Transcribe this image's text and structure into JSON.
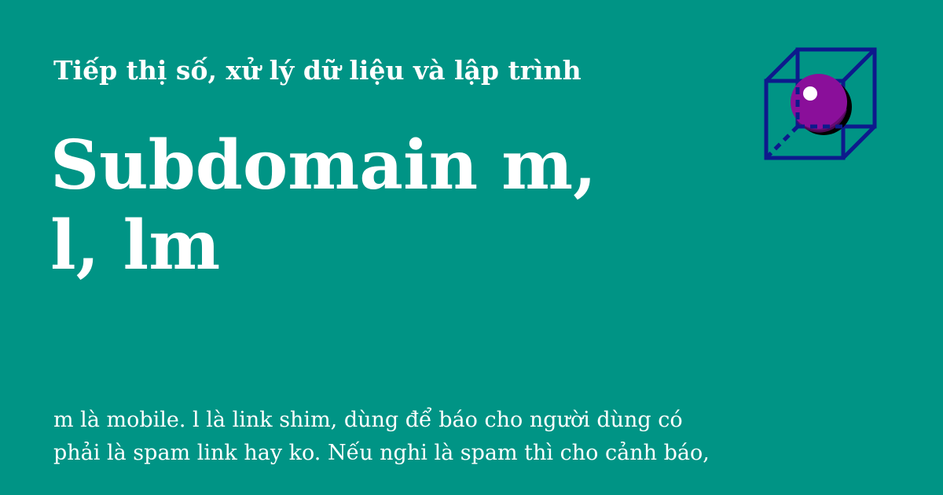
{
  "site": {
    "name": "Tiếp thị số, xử lý dữ liệu và lập trình"
  },
  "post": {
    "title": "Subdomain m, l, lm",
    "excerpt": "m là mobile. l là link shim, dùng để báo cho người dùng có phải là spam link hay ko. Nếu nghi là spam thì cho cảnh báo,"
  },
  "logo": {
    "icon": "cube-with-sphere-icon",
    "colors": {
      "background": "#009485",
      "cube_edges": "#0d1a8c",
      "sphere": "#8a0f9a",
      "sphere_shadow": "#000000",
      "highlight": "#ffffff"
    }
  }
}
